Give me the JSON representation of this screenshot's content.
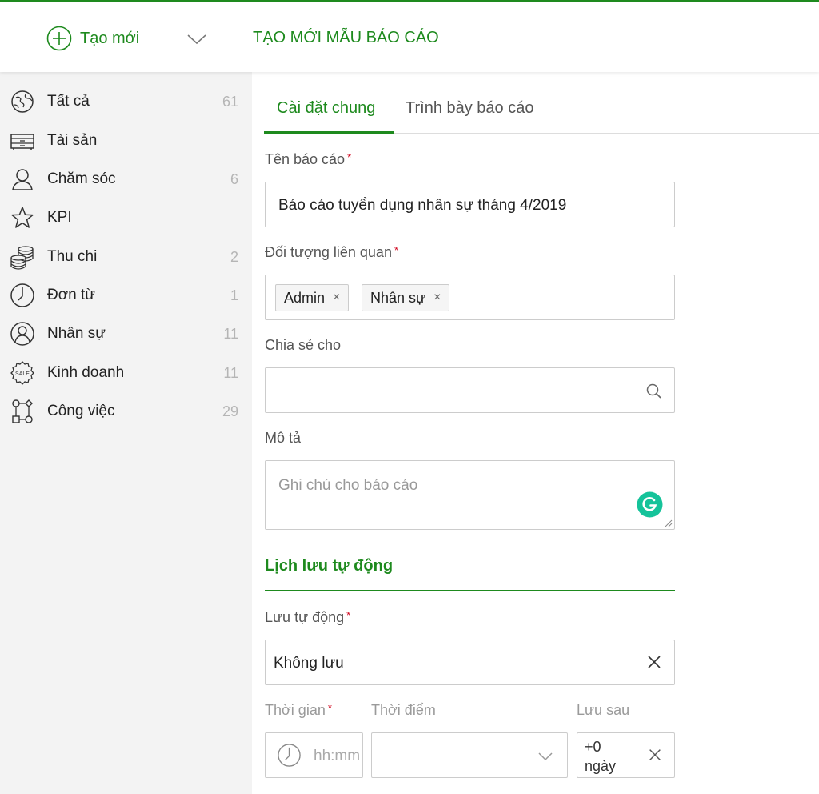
{
  "header": {
    "create_label": "Tạo mới",
    "page_title": "TẠO MỚI MẪU BÁO CÁO"
  },
  "sidebar": {
    "items": [
      {
        "label": "Tất cả",
        "count": "61",
        "icon": "globe-icon"
      },
      {
        "label": "Tài sản",
        "count": "",
        "icon": "cabinet-icon"
      },
      {
        "label": "Chăm sóc",
        "count": "6",
        "icon": "user-icon"
      },
      {
        "label": "KPI",
        "count": "",
        "icon": "star-icon"
      },
      {
        "label": "Thu chi",
        "count": "2",
        "icon": "coins-icon"
      },
      {
        "label": "Đơn từ",
        "count": "1",
        "icon": "clock-icon"
      },
      {
        "label": "Nhân sự",
        "count": "11",
        "icon": "person-circle-icon"
      },
      {
        "label": "Kinh doanh",
        "count": "11",
        "icon": "sale-badge-icon"
      },
      {
        "label": "Công việc",
        "count": "29",
        "icon": "workflow-icon"
      }
    ]
  },
  "tabs": [
    {
      "label": "Cài đặt chung",
      "active": true
    },
    {
      "label": "Trình bày báo cáo",
      "active": false
    }
  ],
  "form": {
    "name_label": "Tên báo cáo",
    "name_value": "Báo cáo tuyển dụng nhân sự tháng 4/2019",
    "related_label": "Đối tượng liên quan",
    "related_tags": [
      "Admin",
      "Nhân sự"
    ],
    "share_label": "Chia sẻ cho",
    "share_value": "",
    "desc_label": "Mô tả",
    "desc_placeholder": "Ghi chú cho báo cáo",
    "required_mark": "*",
    "tag_remove": "×"
  },
  "schedule": {
    "section_title": "Lịch lưu tự động",
    "auto_save_label": "Lưu tự động",
    "auto_save_value": "Không lưu",
    "time_label": "Thời gian",
    "time_placeholder": "hh:mm",
    "moment_label": "Thời điểm",
    "moment_value": "",
    "save_after_label": "Lưu sau",
    "save_after_value": "+0 ngày"
  },
  "colors": {
    "accent": "#1e8a1e",
    "required": "#d0021b",
    "grammarly": "#15c39a"
  }
}
